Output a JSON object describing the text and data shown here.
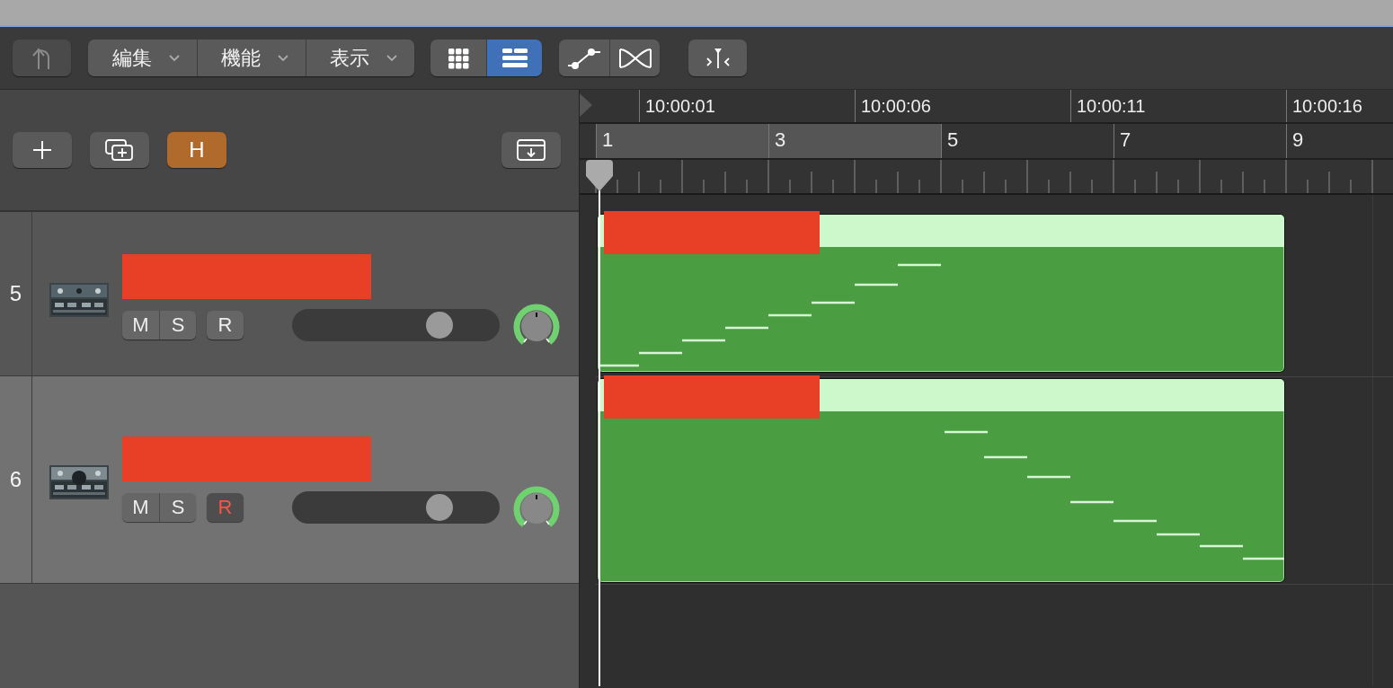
{
  "toolbar": {
    "menus": [
      {
        "label": "編集"
      },
      {
        "label": "機能"
      },
      {
        "label": "表示"
      }
    ],
    "view_toggles": [
      {
        "kind": "grid",
        "selected": false
      },
      {
        "kind": "list",
        "selected": true
      }
    ]
  },
  "track_header": {
    "hide_button": {
      "label": "H",
      "on": true
    }
  },
  "ruler": {
    "timecodes": [
      "10:00:01",
      "10:00:06",
      "10:00:11",
      "10:00:16"
    ],
    "bars": [
      "1",
      "3",
      "5",
      "7",
      "9"
    ]
  },
  "tracks": [
    {
      "number": "5",
      "selected": false,
      "name_redacted": true,
      "mute": "M",
      "solo": "S",
      "record": {
        "label": "R",
        "armed": false
      },
      "volume": {
        "level": 0.71
      },
      "region": {
        "name_redacted": true
      }
    },
    {
      "number": "6",
      "selected": true,
      "name_redacted": true,
      "mute": "M",
      "solo": "S",
      "record": {
        "label": "R",
        "armed": true
      },
      "volume": {
        "level": 0.71
      },
      "region": {
        "name_redacted": true
      }
    }
  ]
}
